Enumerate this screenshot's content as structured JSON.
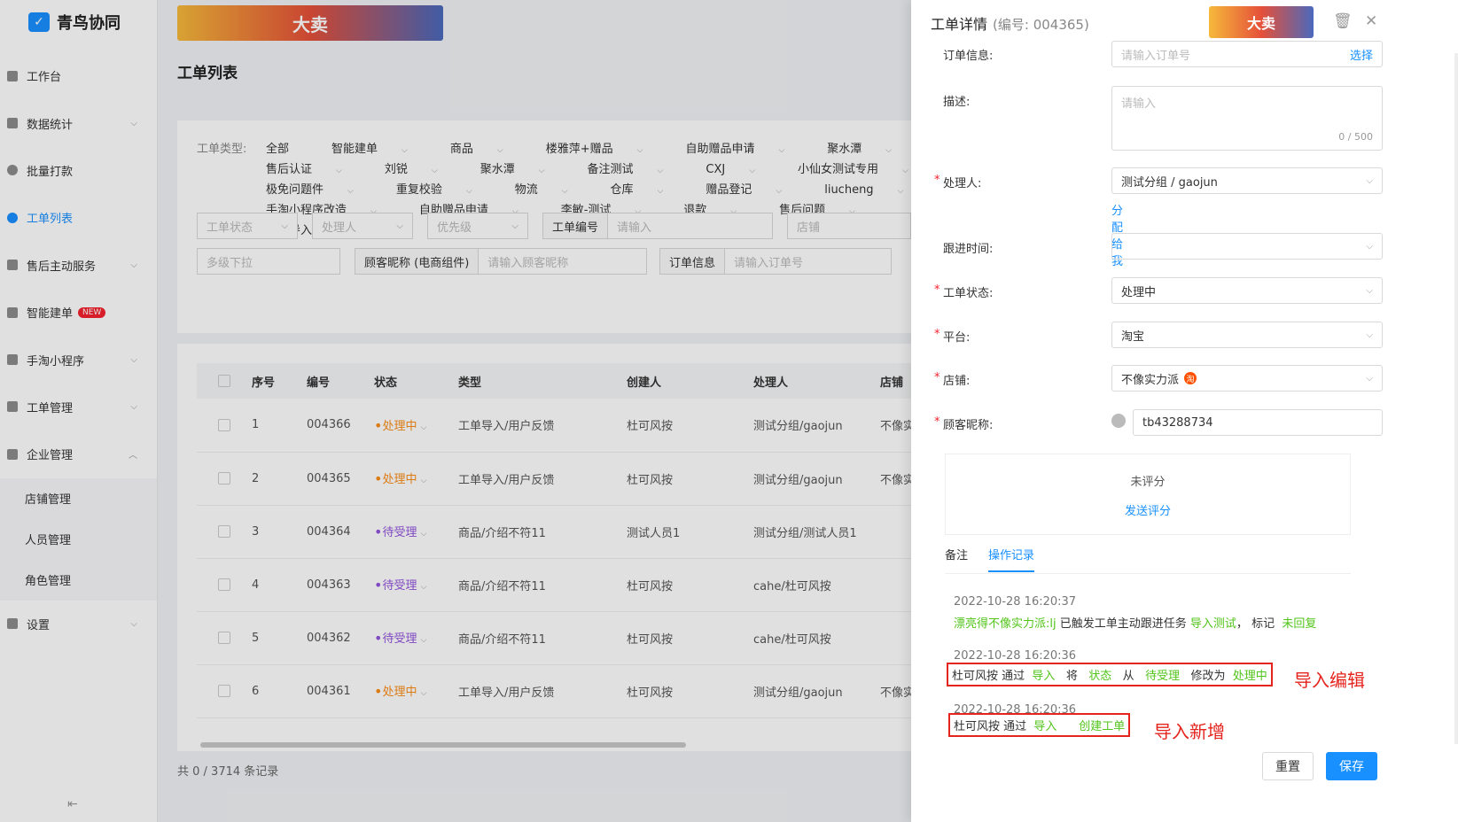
{
  "app": {
    "name": "青鸟协同"
  },
  "sidebar": {
    "items": [
      {
        "label": "工作台"
      },
      {
        "label": "数据统计"
      },
      {
        "label": "批量打款"
      },
      {
        "label": "工单列表"
      },
      {
        "label": "售后主动服务"
      },
      {
        "label": "智能建单",
        "badge": "NEW"
      },
      {
        "label": "手淘小程序"
      },
      {
        "label": "工单管理"
      },
      {
        "label": "企业管理"
      },
      {
        "label": "店铺管理"
      },
      {
        "label": "人员管理"
      },
      {
        "label": "角色管理"
      },
      {
        "label": "设置"
      }
    ],
    "collapse_glyph": "⇤"
  },
  "main": {
    "banner": "大卖",
    "title": "工单列表",
    "type_label": "工单类型:",
    "types": [
      "全部",
      "智能建单",
      "商品",
      "楼雅萍+赠品",
      "自助赠品申请",
      "聚水潭",
      "售后认证",
      "刘锐",
      "聚水潭",
      "备注测试",
      "CXJ",
      "小仙女测试专用",
      "极免问题件",
      "重复校验",
      "物流",
      "仓库",
      "赠品登记",
      "liucheng",
      "手淘小程序改造",
      "自助赠品申请",
      "李敏-测试",
      "退款",
      "售后问题",
      "工单导入"
    ],
    "filters": {
      "status": "工单状态",
      "handler": "处理人",
      "priority": "优先级",
      "no_label": "工单编号",
      "no_ph": "请输入",
      "shop": "店铺",
      "multi": "多级下拉",
      "nick_label": "顾客昵称 (电商组件)",
      "nick_ph": "请输入顾客昵称",
      "order_label": "订单信息",
      "order_ph": "请输入订单号"
    },
    "table": {
      "headers": [
        "序号",
        "编号",
        "状态",
        "类型",
        "创建人",
        "处理人",
        "店铺"
      ],
      "rows": [
        {
          "idx": "1",
          "no": "004366",
          "status": "处理中",
          "type": "工单导入/用户反馈",
          "creator": "杜可风按",
          "handler": "测试分组/gaojun",
          "shop": "不像实"
        },
        {
          "idx": "2",
          "no": "004365",
          "status": "处理中",
          "type": "工单导入/用户反馈",
          "creator": "杜可风按",
          "handler": "测试分组/gaojun",
          "shop": "不像实"
        },
        {
          "idx": "3",
          "no": "004364",
          "status": "待受理",
          "type": "商品/介绍不符11",
          "creator": "测试人员1",
          "handler": "测试分组/测试人员1",
          "shop": ""
        },
        {
          "idx": "4",
          "no": "004363",
          "status": "待受理",
          "type": "商品/介绍不符11",
          "creator": "杜可风按",
          "handler": "cahe/杜可风按",
          "shop": ""
        },
        {
          "idx": "5",
          "no": "004362",
          "status": "待受理",
          "type": "商品/介绍不符11",
          "creator": "杜可风按",
          "handler": "cahe/杜可风按",
          "shop": ""
        },
        {
          "idx": "6",
          "no": "004361",
          "status": "处理中",
          "type": "工单导入/用户反馈",
          "creator": "杜可风按",
          "handler": "测试分组/gaojun",
          "shop": "不像实"
        }
      ]
    },
    "pager": "共 0 / 3714 条记录"
  },
  "drawer": {
    "title": "工单详情",
    "sub": "(编号: 004365)",
    "ad": "大卖",
    "order_label": "订单信息:",
    "order_ph": "请输入订单号",
    "order_action": "选择",
    "desc_label": "描述:",
    "desc_ph": "请输入",
    "desc_count": "0 / 500",
    "handler_label": "处理人:",
    "handler_value": "测试分组 / gaojun",
    "assign_me": "分配给我",
    "followup_label": "跟进时间:",
    "status_label": "工单状态:",
    "status_value": "处理中",
    "platform_label": "平台:",
    "platform_value": "淘宝",
    "shop_label": "店铺:",
    "shop_value": "不像实力派",
    "shop_badge": "淘",
    "nick_label": "顾客昵称:",
    "nick_value": "tb43288734",
    "rating": "未评分",
    "send_rating": "发送评分",
    "tab_notes": "备注",
    "tab_ops": "操作记录",
    "logs": [
      {
        "ts": "2022-10-28 16:20:37",
        "parts": [
          "漂亮得不像实力派:lj",
          "已触发工单主动跟进任务",
          "导入测试",
          "，",
          "标记",
          "未回复"
        ]
      },
      {
        "ts": "2022-10-28 16:20:36",
        "parts": [
          "杜可风按 通过",
          "导入",
          "将",
          "状态",
          "从",
          "待受理",
          "修改为",
          "处理中"
        ]
      },
      {
        "ts": "2022-10-28 16:20:36",
        "parts": [
          "杜可风按 通过",
          "导入",
          "创建工单"
        ]
      }
    ],
    "anno_edit": "导入编辑",
    "anno_add": "导入新增",
    "reset": "重置",
    "save": "保存",
    "colors": {
      "accent": "#1890ff",
      "success": "#52c41a",
      "processing": "#fa8c16",
      "pending": "#9254de",
      "annotation": "#e5241e"
    }
  }
}
